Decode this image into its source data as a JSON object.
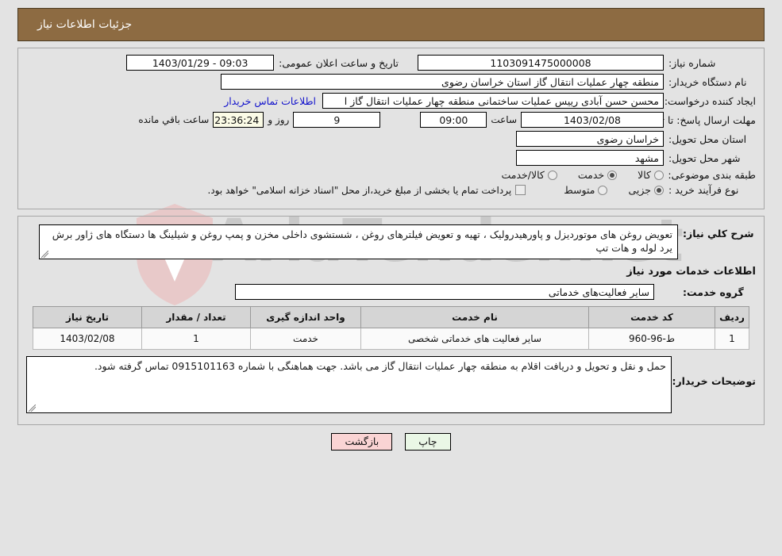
{
  "header": {
    "title": "جزئیات اطلاعات نیاز",
    "bar_color": "#8d6b42"
  },
  "watermark": {
    "text": "AriaTender.net",
    "shield_color": "#e8c9c9"
  },
  "info": {
    "need_number_label": "شماره نیاز:",
    "need_number_value": "1103091475000008",
    "announce_label": "تاریخ و ساعت اعلان عمومی:",
    "announce_value": "09:03 - 1403/01/29",
    "buyer_org_label": "نام دستگاه خریدار:",
    "buyer_org_value": "منطقه چهار عملیات انتقال گاز   استان خراسان رضوی",
    "creator_label": "ایجاد کننده درخواست:",
    "creator_value": "محسن حسن آبادی رییس عملیات ساختمانی منطقه چهار عملیات انتقال گاز   ا",
    "contact_link": "اطلاعات تماس خریدار",
    "deadline_label": "مهلت ارسال پاسخ: تا تاریخ:",
    "deadline_date": "1403/02/08",
    "time_label": "ساعت",
    "deadline_time": "09:00",
    "days_value": "9",
    "days_label": "روز و",
    "countdown_value": "23:36:24",
    "remaining_label": "ساعت باقي مانده",
    "province_label": "استان محل تحویل:",
    "province_value": "خراسان رضوی",
    "city_label": "شهر محل تحویل:",
    "city_value": "مشهد",
    "category_label": "طبقه بندی موضوعی:",
    "category_options": [
      {
        "label": "کالا",
        "selected": false
      },
      {
        "label": "خدمت",
        "selected": true
      },
      {
        "label": "کالا/خدمت",
        "selected": false
      }
    ],
    "process_label": "نوع فرآیند خرید :",
    "process_options": [
      {
        "label": "جزیی",
        "selected": true
      },
      {
        "label": "متوسط",
        "selected": false
      }
    ],
    "treasury_checked": false,
    "treasury_text": "پرداخت تمام یا بخشی از مبلغ خرید،از محل \"اسناد خزانه اسلامی\" خواهد بود."
  },
  "description": {
    "label": "شرح کلي نياز:",
    "value": "تعویض روغن های موتوردیزل و پاورهیدرولیک ، تهیه و تعویض فیلترهای روغن ، شستشوی داخلی مخزن و پمپ روغن و شیلینگ ها دستگاه های ژاور برش یرد لوله و هات تپ"
  },
  "services": {
    "section_title": "اطلاعات خدمات مورد نیاز",
    "group_label": "گروه خدمت:",
    "group_value": "سایر فعالیت‌های خدماتی",
    "columns": [
      "ردیف",
      "کد خدمت",
      "نام خدمت",
      "واحد اندازه گیری",
      "تعداد / مقدار",
      "تاریخ نیاز"
    ],
    "rows": [
      {
        "index": "1",
        "code": "ط-96-960",
        "name": "سایر فعالیت های خدماتی شخصی",
        "unit": "خدمت",
        "qty": "1",
        "date": "1403/02/08"
      }
    ]
  },
  "notes": {
    "label": "توضیحات خریدار:",
    "value": "حمل و نقل و تحویل و دریافت اقلام به منطقه چهار عملیات انتقال گاز می باشد. جهت هماهنگی با شماره 0915101163 تماس گرفته شود."
  },
  "footer": {
    "back_label": "بازگشت",
    "print_label": "چاپ"
  }
}
